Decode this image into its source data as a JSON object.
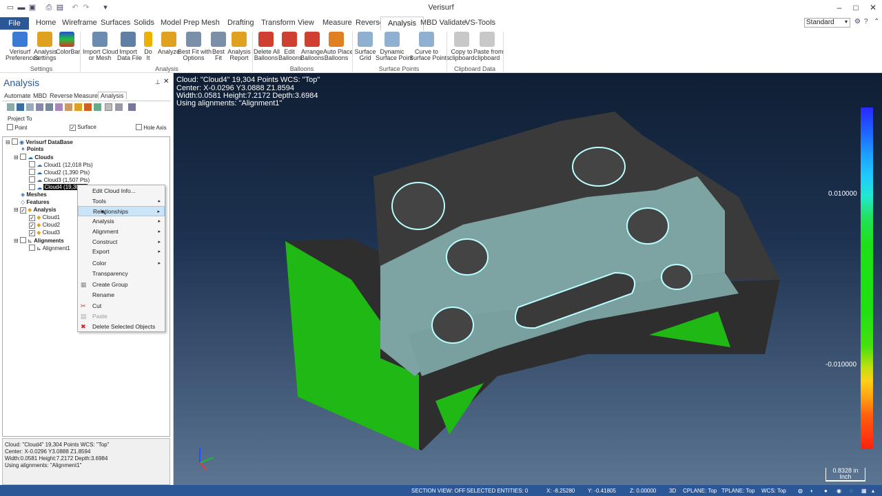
{
  "window": {
    "title": "Verisurf"
  },
  "menu": {
    "file": "File",
    "items": [
      "Home",
      "Wireframe",
      "Surfaces",
      "Solids",
      "Model Prep",
      "Mesh",
      "Drafting",
      "Transform",
      "View",
      "Measure",
      "Reverse",
      "Analysis",
      "MBD Validate",
      "VS-Tools"
    ],
    "standard": "Standard"
  },
  "ribbon": {
    "buttons": [
      {
        "label": "Verisurf\nPreferences"
      },
      {
        "label": "Analysis\nSettings"
      },
      {
        "label": "ColorBar"
      },
      {
        "label": "Import Cloud\nor Mesh"
      },
      {
        "label": "Import\nData File"
      },
      {
        "label": "Do\nIt"
      },
      {
        "label": "Analyze"
      },
      {
        "label": "Best Fit with\nOptions"
      },
      {
        "label": "Best\nFit"
      },
      {
        "label": "Analysis\nReport"
      },
      {
        "label": "Delete All\nBalloons"
      },
      {
        "label": "Edit\nBalloons"
      },
      {
        "label": "Arrange\nBalloons"
      },
      {
        "label": "Auto Place\nBalloons"
      },
      {
        "label": "Surface\nGrid"
      },
      {
        "label": "Dynamic\nSurface Point"
      },
      {
        "label": "Curve to\nSurface Points"
      },
      {
        "label": "Copy to\nclipboard"
      },
      {
        "label": "Paste from\nclipboard"
      }
    ],
    "groups": [
      "Settings",
      "Analysis",
      "Balloons",
      "Surface Points",
      "Clipboard Data"
    ]
  },
  "panel": {
    "title": "Analysis",
    "tabs": [
      "Automate",
      "MBD",
      "Reverse",
      "Measure",
      "Analysis"
    ],
    "project_to": "Project To",
    "point": "Point",
    "surface": "Surface",
    "hole_axis": "Hole Axis",
    "tree": {
      "root": "Verisurf DataBase",
      "points": "Points",
      "clouds": "Clouds",
      "cloud_items": [
        "Cloud1 (12,018 Pts)",
        "Cloud2 (1,390 Pts)",
        "Cloud3 (1,507 Pts)",
        "Cloud4 (19,304 Pts)"
      ],
      "meshes": "Meshes",
      "features": "Features",
      "analysis": "Analysis",
      "analysis_items": [
        "Cloud1",
        "Cloud2",
        "Cloud3"
      ],
      "alignments": "Alignments",
      "alignment_items": [
        "Alignment1"
      ]
    },
    "info": [
      "Cloud: \"Cloud4\" 19,304 Points  WCS: \"Top\"",
      "Center: X-0.0296 Y3.0888 Z1.8594",
      "Width:0.0581 Height:7.2172 Depth:3.6984",
      "Using alignments: \"Alignment1\""
    ]
  },
  "context_menu": [
    {
      "label": "Edit Cloud Info...",
      "sub": false
    },
    {
      "label": "Tools",
      "sub": true
    },
    {
      "label": "Relationships",
      "sub": true
    },
    {
      "label": "Analysis",
      "sub": true
    },
    {
      "label": "Alignment",
      "sub": true
    },
    {
      "label": "Construct",
      "sub": true
    },
    {
      "label": "Export",
      "sub": true
    },
    {
      "label": "Color",
      "sub": true
    },
    {
      "label": "Transparency",
      "sub": false
    },
    {
      "label": "Create Group",
      "sub": false
    },
    {
      "label": "Rename",
      "sub": false
    },
    {
      "label": "Cut",
      "sub": false
    },
    {
      "label": "Paste",
      "sub": false
    },
    {
      "label": "Delete Selected Objects",
      "sub": false
    }
  ],
  "viewport": {
    "info": [
      "Cloud: \"Cloud4\" 19,304 Points  WCS: \"Top\"",
      "Center: X-0.0296 Y3.0888 Z1.8594",
      "Width:0.0581 Height:7.2172 Depth:3.6984",
      "Using alignments: \"Alignment1\""
    ],
    "colorbar_top": "0.010000",
    "colorbar_bottom": "-0.010000",
    "scale": "0.8328 in\nInch",
    "colors": {
      "part": "#3a3a3a",
      "green": "#1fb814",
      "cloud": "#7ea3a3"
    }
  },
  "status": {
    "section": "SECTION VIEW: OFF",
    "selected": "SELECTED ENTITIES: 0",
    "x": "X:    -8.25280",
    "y": "Y:    -0.41805",
    "z": "Z:    0.00000",
    "mode": "3D",
    "cplane": "CPLANE: Top",
    "tplane": "TPLANE: Top",
    "wcs": "WCS: Top"
  }
}
